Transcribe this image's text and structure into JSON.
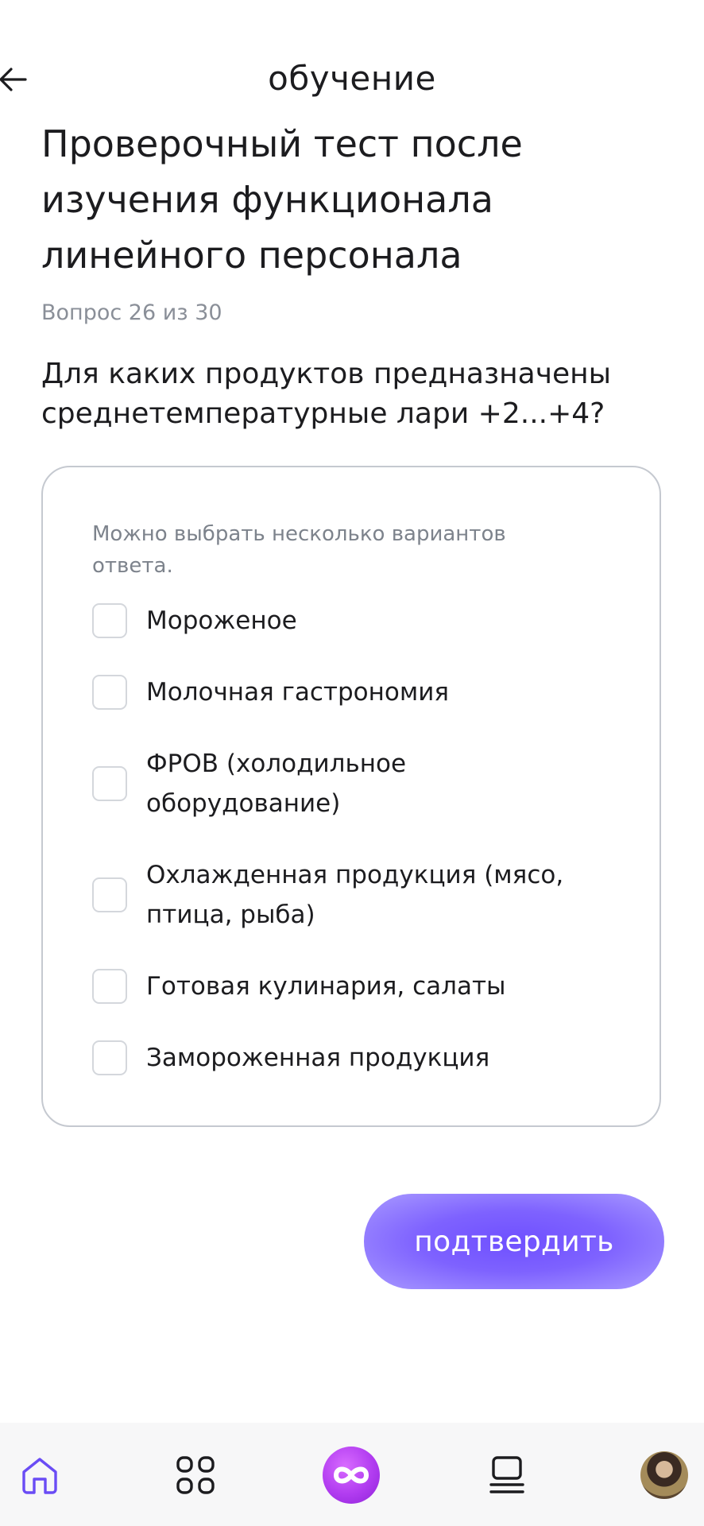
{
  "header": {
    "title": "обучение"
  },
  "test": {
    "title": "Проверочный тест после изучения функционала линейного персонала",
    "counter": "Вопрос 26 из 30",
    "question": "Для каких продуктов предназначены среднетемпературные лари +2...+4?"
  },
  "answers": {
    "hint": "Можно выбрать несколько вариантов ответа.",
    "options": [
      {
        "label": "Мороженое",
        "checked": false
      },
      {
        "label": "Молочная гастрономия",
        "checked": false
      },
      {
        "label": "ФРОВ (холодильное оборудование)",
        "checked": false
      },
      {
        "label": "Охлажденная продукция (мясо, птица, рыба)",
        "checked": false
      },
      {
        "label": "Готовая кулинария, салаты",
        "checked": false
      },
      {
        "label": "Замороженная продукция",
        "checked": false
      }
    ]
  },
  "confirm_label": "подтвердить",
  "bottom_nav": {
    "items": [
      {
        "icon": "home-icon",
        "active": true
      },
      {
        "icon": "grid-icon",
        "active": false
      },
      {
        "icon": "infinity-icon",
        "active": false
      },
      {
        "icon": "courses-icon",
        "active": false
      },
      {
        "icon": "avatar",
        "active": false
      }
    ]
  },
  "colors": {
    "accent": "#6f50ff",
    "accent_light": "#a99aff",
    "center_nav": "#b13cf0",
    "home_icon": "#6a4cf5",
    "muted_text": "#8a8f98",
    "border": "#c5c9d0"
  }
}
